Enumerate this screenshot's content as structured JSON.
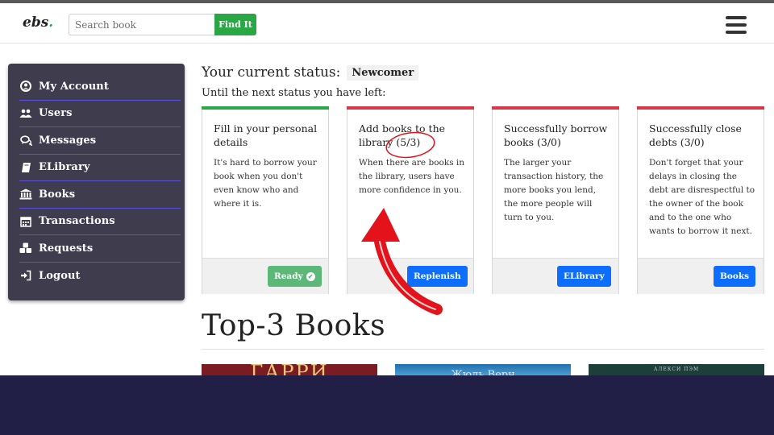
{
  "navbar": {
    "logo_text": "ebs",
    "logo_dot": ".",
    "search_placeholder": "Search book",
    "search_value": "",
    "find_label": "Find It",
    "menu_icon": "hamburger-icon"
  },
  "sidebar": {
    "items": [
      {
        "label": "My Account",
        "icon": "user-circle-icon"
      },
      {
        "label": "Users",
        "icon": "users-icon"
      },
      {
        "label": "Messages",
        "icon": "chat-icon"
      },
      {
        "label": "ELibrary",
        "icon": "book-icon"
      },
      {
        "label": "Books",
        "icon": "bank-icon"
      },
      {
        "label": "Transactions",
        "icon": "calendar-icon"
      },
      {
        "label": "Requests",
        "icon": "cubes-icon"
      },
      {
        "label": "Logout",
        "icon": "logout-icon"
      }
    ]
  },
  "status": {
    "title": "Your current status:",
    "badge": "Newcomer",
    "subtitle": "Until the next status you have left:"
  },
  "cards": [
    {
      "title": "Fill in your personal details",
      "text": "It's hard to borrow your book when you don't even know who and where it is.",
      "button": "Ready",
      "bar_color": "#28a745",
      "button_color": "green"
    },
    {
      "title": "Add books to the library (5/3)",
      "text": "When there are books in the library, users have more confidence in you.",
      "button": "Replenish",
      "bar_color": "#dc3545",
      "button_color": "blue"
    },
    {
      "title": "Successfully borrow books (3/0)",
      "text": "The larger your transaction history, the more books you lend, the more people will turn to you.",
      "button": "ELibrary",
      "bar_color": "#dc3545",
      "button_color": "blue"
    },
    {
      "title": "Successfully close debts (3/0)",
      "text": "Don't forget that your delays in closing the debt are disrespectful to the owner of the book and to the one who wants to borrow it next.",
      "button": "Books",
      "bar_color": "#dc3545",
      "button_color": "blue"
    }
  ],
  "top_books": {
    "heading": "Top-3 Books",
    "covers": [
      {
        "text": "ГАРРИ",
        "bg": "#7a1c22"
      },
      {
        "text": "Жюль Верн",
        "bg": "#3f8fc8"
      },
      {
        "text": "АЛЕКСИ ПЭМ",
        "bg": "#1d3f3c"
      }
    ]
  },
  "colors": {
    "sidebar_bg": "#3f3c4e",
    "sidebar_divider": "#5a4fd6",
    "accent_green": "#28a745",
    "accent_blue": "#0d6efd",
    "annotation_red": "#e3121b",
    "bottom_band": "#221f47"
  }
}
